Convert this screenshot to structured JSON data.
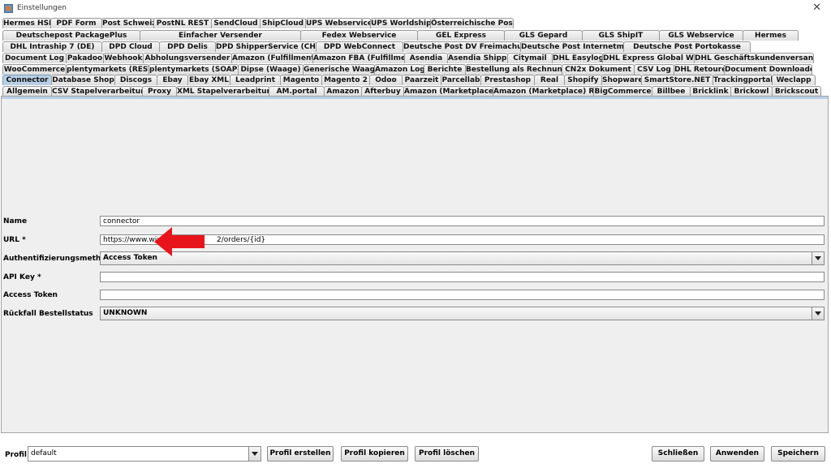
{
  "window": {
    "title": "Einstellungen",
    "close_glyph": "✕"
  },
  "tab_rows": [
    [
      "Hermes HSI",
      "PDF Form",
      "Post Schweiz",
      "PostNL REST",
      "SendCloud",
      "ShipCloud",
      "UPS Webservice",
      "UPS Worldship",
      "Österreichische Post"
    ],
    [
      "Deutschepost PackagePlus",
      "Einfacher Versender",
      "Fedex Webservice",
      "GEL Express",
      "GLS Gepard",
      "GLS ShipIT",
      "GLS Webservice",
      "Hermes"
    ],
    [
      "DHL Intraship 7 (DE)",
      "DPD Cloud",
      "DPD Delis",
      "DPD ShipperService (CH)",
      "DPD WebConnect",
      "Deutsche Post DV Freimachung",
      "Deutsche Post Internetmarke",
      "Deutsche Post Portokasse"
    ],
    [
      "Document Log",
      "Pakadoo",
      "Webhook",
      "Abholungsversender",
      "Amazon (Fulfillment)",
      "Amazon FBA (Fulfillment)",
      "Asendia",
      "Asendia Shipping",
      "Citymail",
      "DHL Easylog",
      "DHL Express Global WS",
      "DHL Geschäftskundenversand"
    ],
    [
      "WooCommerce",
      "plentymarkets (REST)",
      "plentymarkets (SOAP)",
      "Dipse (Waage)",
      "Generische Waage",
      "Amazon Log",
      "Berichte",
      "Bestellung als Rechnung",
      "CN2x Dokument",
      "CSV Log",
      "DHL Retoure",
      "Document Downloader"
    ],
    [
      "Connector",
      "Database Shop",
      "Discogs",
      "Ebay",
      "Ebay XML",
      "Leadprint",
      "Magento",
      "Magento 2",
      "Odoo",
      "Paarzeit",
      "Parcellab",
      "Prestashop",
      "Real",
      "Shopify",
      "Shopware",
      "SmartStore.NET",
      "Trackingportal",
      "Weclapp"
    ],
    [
      "Allgemein",
      "CSV Stapelverarbeitung",
      "Proxy",
      "XML Stapelverarbeitung",
      "AM.portal",
      "Amazon",
      "Afterbuy",
      "Amazon (Marketplace)",
      "Amazon (Marketplace) REST",
      "BigCommerce",
      "Billbee",
      "Bricklink",
      "Brickowl",
      "Brickscout"
    ]
  ],
  "active_tab": "Connector",
  "form": {
    "name_label": "Name",
    "name_value": "connector",
    "url_label": "URL *",
    "url_value": "https://www.wixap                    2/orders/{id}",
    "auth_label": "Authentifizierungsmethode",
    "auth_value": "Access Token",
    "apikey_label": "API Key *",
    "apikey_value": "",
    "token_label": "Access Token",
    "token_value": "",
    "fallback_label": "Rückfall Bestellstatus",
    "fallback_value": "UNKNOWN"
  },
  "bottom": {
    "profile_label": "Profil",
    "profile_value": "default",
    "create": "Profil erstellen",
    "copy": "Profil kopieren",
    "delete": "Profil löschen",
    "close": "Schließen",
    "apply": "Anwenden",
    "save": "Speichern"
  },
  "colors": {
    "active_tab": "#b8cfe5",
    "annotation_arrow": "#e8141b"
  }
}
